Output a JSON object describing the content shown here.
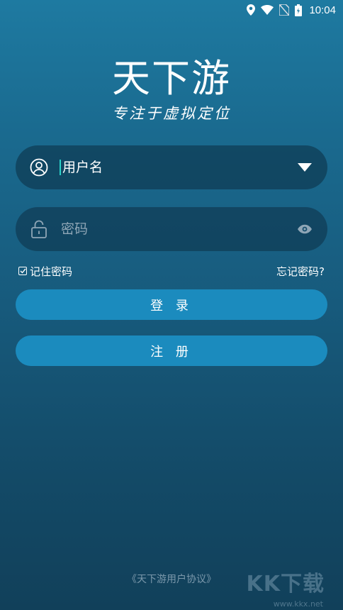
{
  "status_bar": {
    "time": "10:04",
    "icons": [
      "location-icon",
      "wifi-icon",
      "no-sim-icon",
      "battery-icon"
    ]
  },
  "app": {
    "title": "天下游",
    "slogan": "专注于虚拟定位"
  },
  "username_field": {
    "value": "用户名",
    "icon": "user-circle-icon",
    "trailing_icon": "dropdown-triangle-icon"
  },
  "password_field": {
    "placeholder": "密码",
    "icon": "lock-icon",
    "trailing_icon": "eye-icon"
  },
  "options": {
    "remember_label": "记住密码",
    "remember_checked": true,
    "forgot_label": "忘记密码?"
  },
  "buttons": {
    "login_label": "登 录",
    "register_label": "注 册"
  },
  "footer": {
    "agreement": "《天下游用户协议》"
  },
  "watermark": {
    "logo_text": "KK下载",
    "url": "www.kkx.net"
  },
  "colors": {
    "bg_top": "#1e7aa1",
    "bg_bottom": "#11405a",
    "button": "#1b8bbe",
    "cursor": "#2bd2c8"
  }
}
